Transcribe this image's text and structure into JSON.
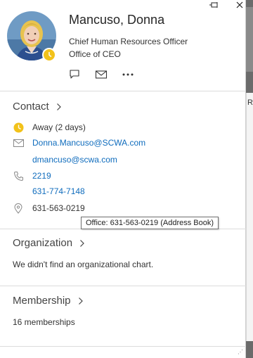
{
  "profile": {
    "name": "Mancuso, Donna",
    "title": "Chief Human Resources Officer",
    "department": "Office of CEO",
    "presence_color": "#f2c21a"
  },
  "window": {
    "pin_icon": "pin-icon",
    "close_icon": "close-icon"
  },
  "actions": {
    "chat_icon": "chat-icon",
    "mail_icon": "mail-icon",
    "more_icon": "more-icon"
  },
  "contact": {
    "heading": "Contact",
    "status": "Away (2 days)",
    "email_primary": "Donna.Mancuso@SCWA.com",
    "email_secondary": "dmancuso@scwa.com",
    "phone_ext": "2219",
    "phone_mobile": "631-774-7148",
    "office_phone": "631-563-0219"
  },
  "tooltip": {
    "text": "Office: 631-563-0219  (Address Book)"
  },
  "organization": {
    "heading": "Organization",
    "message": "We didn't find an organizational chart."
  },
  "membership": {
    "heading": "Membership",
    "count_text": "16 memberships"
  },
  "side": {
    "cut_letter": "R"
  },
  "colors": {
    "link": "#0f6cbd",
    "away": "#f2c21a"
  }
}
